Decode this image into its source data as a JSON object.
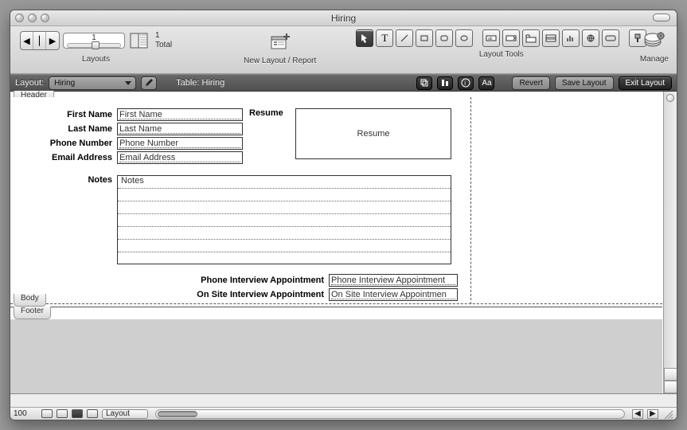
{
  "window": {
    "title": "Hiring"
  },
  "toolbar": {
    "layouts_label": "Layouts",
    "layout_number": "1",
    "record_count": "1",
    "total_label": "Total",
    "new_layout_label": "New Layout / Report",
    "layout_tools_label": "Layout Tools",
    "manage_label": "Manage"
  },
  "layoutbar": {
    "layout_label": "Layout:",
    "layout_value": "Hiring",
    "table_label": "Table: Hiring",
    "revert": "Revert",
    "save": "Save Layout",
    "exit": "Exit Layout"
  },
  "parts": {
    "header": "Header",
    "body": "Body",
    "footer": "Footer"
  },
  "form": {
    "first_name": {
      "label": "First Name",
      "placeholder": "First Name"
    },
    "last_name": {
      "label": "Last Name",
      "placeholder": "Last Name"
    },
    "phone": {
      "label": "Phone Number",
      "placeholder": "Phone Number"
    },
    "email": {
      "label": "Email Address",
      "placeholder": "Email Address"
    },
    "notes": {
      "label": "Notes",
      "placeholder": "Notes"
    },
    "resume": {
      "label": "Resume",
      "placeholder": "Resume"
    },
    "phone_interview": {
      "label": "Phone Interview Appointment",
      "placeholder": "Phone Interview Appointment"
    },
    "onsite_interview": {
      "label": "On Site Interview Appointment",
      "placeholder": "On Site Interview Appointmen"
    }
  },
  "status": {
    "zoom": "100",
    "mode": "Layout"
  }
}
